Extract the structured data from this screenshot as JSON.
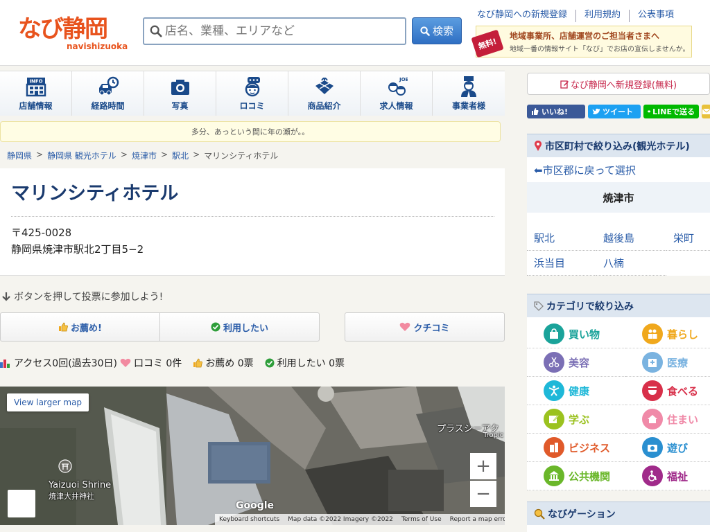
{
  "header": {
    "logo_main": "なび静岡",
    "logo_sub": "navishizuoka",
    "search_placeholder": "店名、業種、エリアなど",
    "search_button": "検索",
    "top_links": [
      "なび静岡への新規登録",
      "利用規約",
      "公表事項"
    ],
    "banner": {
      "badge": "無料!",
      "line1": "地域事業所、店舗運営のご担当者さまへ",
      "line2": "地域一番の情報サイト「なび」でお店の宣伝しませんか。"
    }
  },
  "nav_tabs": [
    {
      "label": "店舗情報",
      "icon": "info-building-icon"
    },
    {
      "label": "経路時間",
      "icon": "car-clock-icon"
    },
    {
      "label": "写真",
      "icon": "camera-icon"
    },
    {
      "label": "ロコミ",
      "icon": "chat-face-icon"
    },
    {
      "label": "商品紹介",
      "icon": "gift-icon"
    },
    {
      "label": "求人情報",
      "icon": "job-people-icon"
    },
    {
      "label": "事業者様",
      "icon": "business-person-icon"
    }
  ],
  "notice": "多分、あっという間に年の瀬が。。",
  "breadcrumb": [
    "静岡県",
    "静岡県 観光ホテル",
    "焼津市",
    "駅北",
    "マリンシティホテル"
  ],
  "shop": {
    "name": "マリンシティホテル",
    "zip": "〒425-0028",
    "address": "静岡県焼津市駅北2丁目5−2"
  },
  "vote": {
    "hint": "ボタンを押して投票に参加しよう!",
    "recommend": "お薦め!",
    "want_use": "利用したい",
    "kuchikomi": "クチコミ"
  },
  "stats": {
    "access": "アクセス0回(過去30日)",
    "kuchikomi": "口コミ 0件",
    "recommend": "お薦め 0票",
    "want_use": "利用したい 0票"
  },
  "map": {
    "larger_link": "View larger map",
    "label_shrine_en": "Yaizuoi Shrine",
    "label_shrine_ja": "焼津大井神社",
    "label_place": "プラスシーアク",
    "label_place2": "Tropic",
    "google": "Google",
    "zoom_in": "+",
    "zoom_out": "−",
    "attrib": [
      "Keyboard shortcuts",
      "Map data ©2022 Imagery ©2022",
      "Terms of Use",
      "Report a map error"
    ]
  },
  "sidebar": {
    "register": "なび静岡へ新規登録(無料)",
    "social": {
      "fb": "いいね!",
      "tw": "ツイート",
      "line": "LINEで送る"
    },
    "area_title": "市区町村で絞り込み(観光ホテル)",
    "back": "⬅市区郡に戻って選択",
    "city": "焼津市",
    "areas": [
      "駅北",
      "越後島",
      "栄町",
      "浜当目",
      "八楠"
    ],
    "category_title": "カテゴリで絞り込み",
    "categories": [
      {
        "label": "買い物",
        "color": "#1aa39a"
      },
      {
        "label": "暮らし",
        "color": "#f0a81c"
      },
      {
        "label": "美容",
        "color": "#7b6fb5"
      },
      {
        "label": "医療",
        "color": "#7ab3e0"
      },
      {
        "label": "健康",
        "color": "#1eb8d8"
      },
      {
        "label": "食べる",
        "color": "#d8304a"
      },
      {
        "label": "学ぶ",
        "color": "#9bc21f"
      },
      {
        "label": "住まい",
        "color": "#f08aa8"
      },
      {
        "label": "ビジネス",
        "color": "#e05a2a"
      },
      {
        "label": "遊び",
        "color": "#2a8fd0"
      },
      {
        "label": "公共機関",
        "color": "#6ab72a"
      },
      {
        "label": "福祉",
        "color": "#a02a8a"
      }
    ],
    "navigation_title": "なびゲーション"
  }
}
